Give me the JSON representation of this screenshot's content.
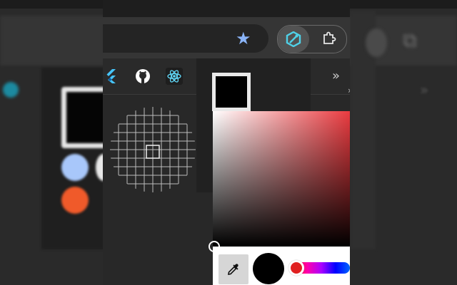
{
  "window": {
    "title": ""
  },
  "toolbar": {
    "bookmark_star_icon": "star-icon",
    "extensions": [
      {
        "name": "color-picker-extension",
        "icon": "eyedropper-hex-icon",
        "active": true,
        "color": "#4fd1e8"
      },
      {
        "name": "extensions-menu",
        "icon": "puzzle-icon",
        "active": false
      }
    ]
  },
  "bookmarks": {
    "items": [
      {
        "name": "flutter",
        "icon": "flutter-icon",
        "color": "#47c5fb"
      },
      {
        "name": "github",
        "icon": "github-icon",
        "color": "#ffffff"
      },
      {
        "name": "react",
        "icon": "react-icon",
        "color": "#61dafb"
      }
    ],
    "overflow_label": "»"
  },
  "popup": {
    "current_color": "#000000",
    "picker": {
      "hue_color": "#ea3b40",
      "selected_color": "#000000",
      "hue_value_degrees": 0
    }
  },
  "colors": {
    "accent": "#8ab4f8",
    "toolbar_bg": "#353535",
    "popup_bg": "#212121"
  }
}
